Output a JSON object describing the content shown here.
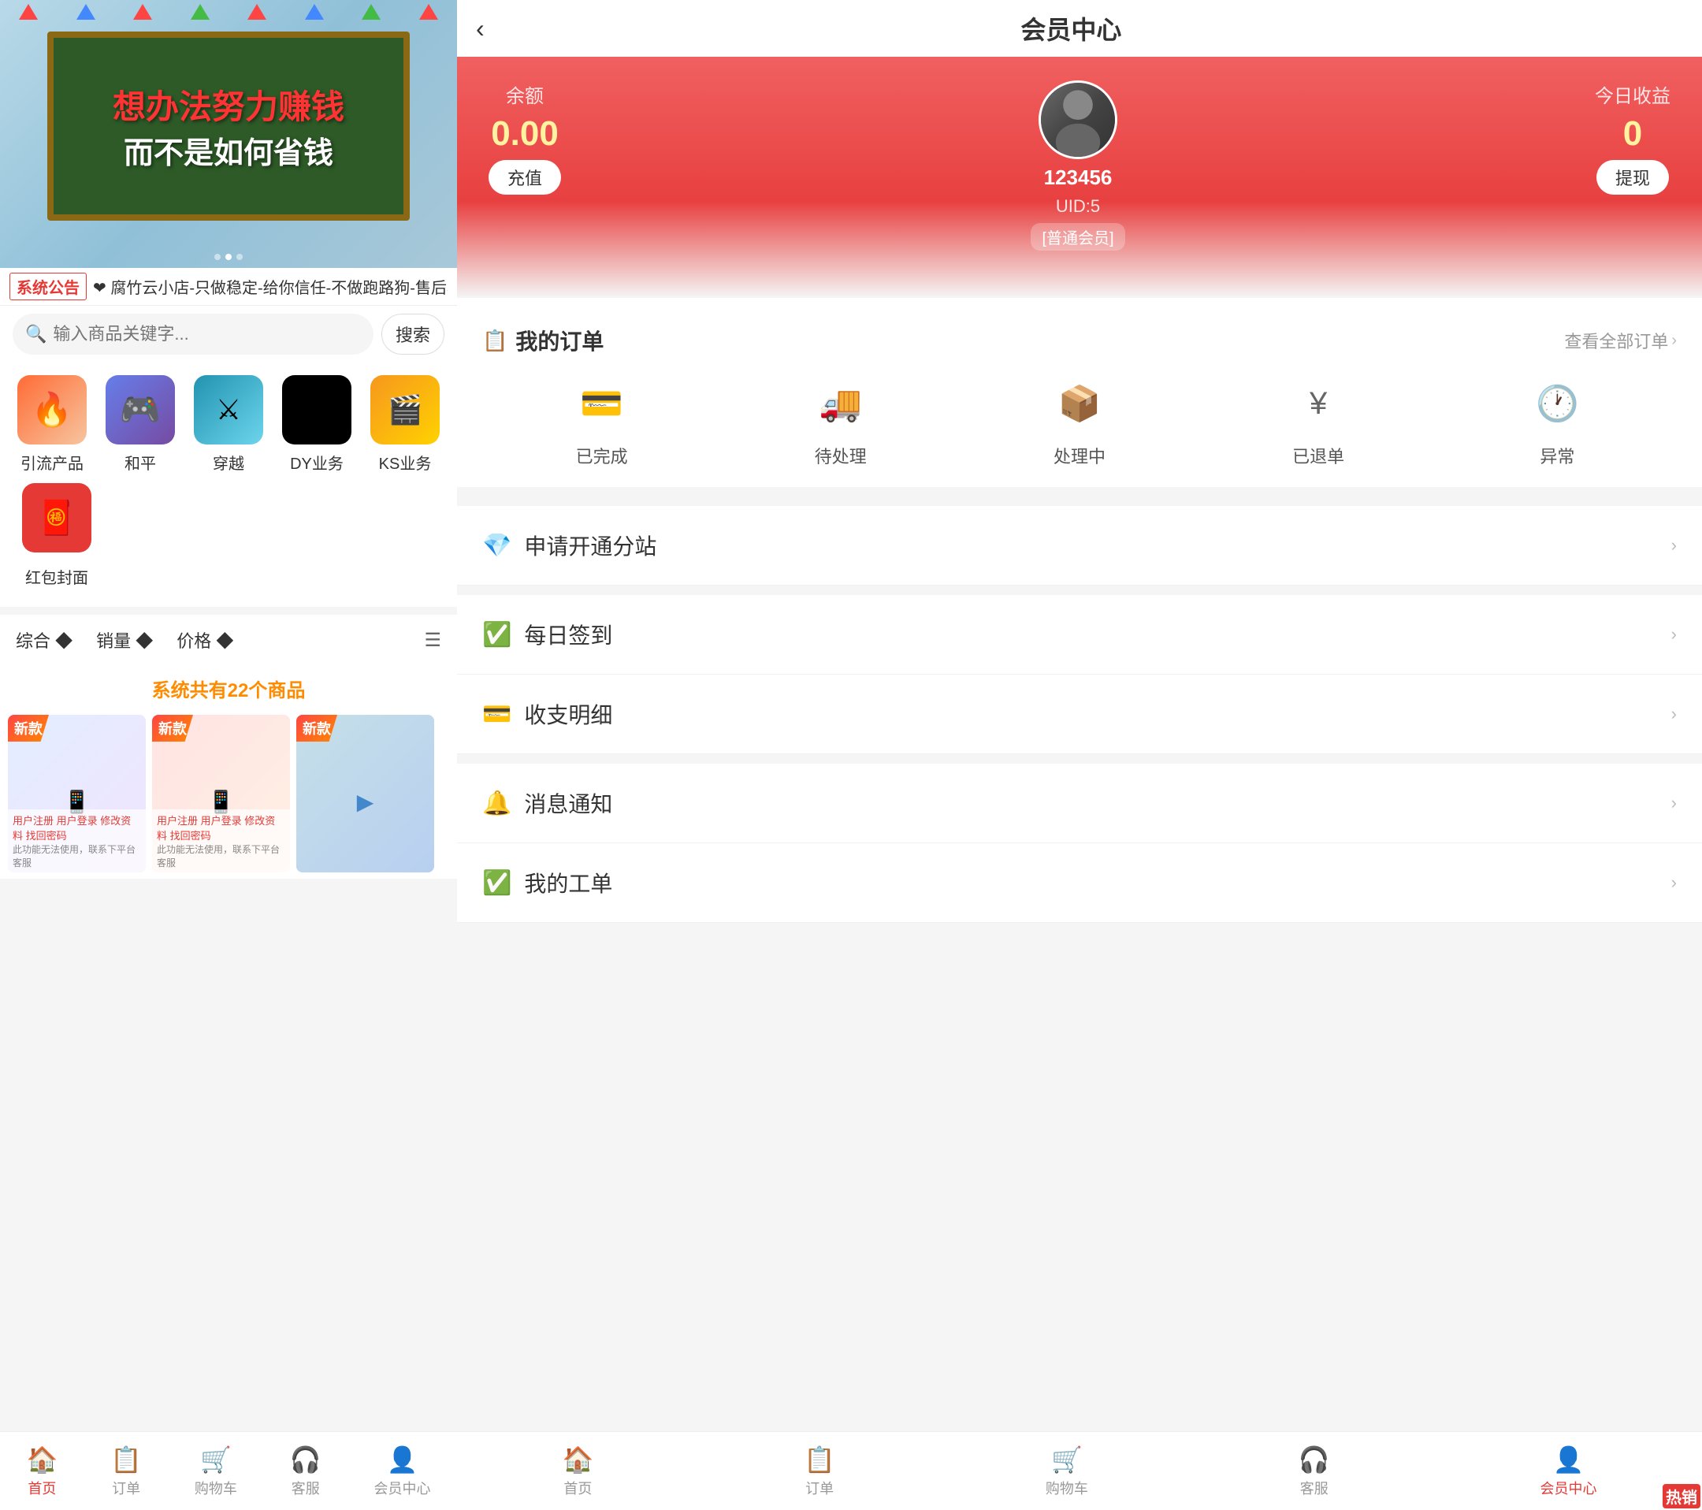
{
  "left": {
    "banner": {
      "text1": "想办法努力赚钱",
      "text2": "而不是如何省钱"
    },
    "notice": {
      "tag": "系统公告",
      "text": "❤ 腐竹云小店-只做稳定-给你信任-不做跑路狗-售后稳定❤"
    },
    "search": {
      "placeholder": "输入商品关键字...",
      "button": "搜索"
    },
    "categories": [
      {
        "label": "引流产品",
        "icon": "🔥",
        "style": "hot"
      },
      {
        "label": "和平",
        "icon": "🎮",
        "style": "peace"
      },
      {
        "label": "穿越",
        "icon": "⚔",
        "style": "cross"
      },
      {
        "label": "DY业务",
        "icon": "♪",
        "style": "dy"
      },
      {
        "label": "KS业务",
        "icon": "🎬",
        "style": "ks"
      }
    ],
    "extra_category": {
      "label": "红包封面",
      "icon": "🧧"
    },
    "sort": {
      "items": [
        "综合 ◆",
        "销量 ◆",
        "价格 ◆"
      ],
      "list_icon": "☰"
    },
    "products_count": "系统共有22个商品",
    "products": [
      {
        "badge": "新款",
        "color1": "#e3eeff",
        "color2": "#f0e3ff"
      },
      {
        "badge": "新款",
        "color1": "#ffe3e3",
        "color2": "#fff0e3"
      },
      {
        "badge": "新款",
        "color1": "#e3f0ff",
        "color2": "#e3ffe8"
      }
    ],
    "nav": {
      "items": [
        {
          "label": "首页",
          "icon": "🏠",
          "active": true
        },
        {
          "label": "订单",
          "icon": "📋",
          "active": false
        },
        {
          "label": "购物车",
          "icon": "🛒",
          "active": false
        },
        {
          "label": "客服",
          "icon": "🎧",
          "active": false
        },
        {
          "label": "会员中心",
          "icon": "👤",
          "active": false
        }
      ]
    }
  },
  "right": {
    "header": {
      "back": "‹",
      "title": "会员中心"
    },
    "hero": {
      "balance_label": "余额",
      "balance_value": "0.00",
      "recharge_btn": "充值",
      "username": "123456",
      "uid": "UID:5",
      "badge": "[普通会员]",
      "earnings_label": "今日收益",
      "earnings_value": "0",
      "withdraw_btn": "提现"
    },
    "orders": {
      "title": "我的订单",
      "link": "查看全部订单",
      "items": [
        {
          "label": "已完成",
          "icon": "💳"
        },
        {
          "label": "待处理",
          "icon": "🚚"
        },
        {
          "label": "处理中",
          "icon": "📦"
        },
        {
          "label": "已退单",
          "icon": "¥"
        },
        {
          "label": "异常",
          "icon": "🕐"
        }
      ]
    },
    "menu": [
      {
        "icon": "💎",
        "text": "申请开通分站",
        "special": true
      },
      {
        "icon": "✅",
        "text": "每日签到",
        "special": false
      },
      {
        "icon": "💳",
        "text": "收支明细",
        "special": false
      },
      {
        "icon": "🔔",
        "text": "消息通知",
        "special": false
      },
      {
        "icon": "✅",
        "text": "我的工单",
        "special": false
      }
    ],
    "nav": {
      "items": [
        {
          "label": "首页",
          "icon": "🏠",
          "active": false
        },
        {
          "label": "订单",
          "icon": "📋",
          "active": false
        },
        {
          "label": "购物车",
          "icon": "🛒",
          "active": false
        },
        {
          "label": "客服",
          "icon": "🎧",
          "active": false
        },
        {
          "label": "会员中心",
          "icon": "👤",
          "active": true
        }
      ]
    }
  }
}
